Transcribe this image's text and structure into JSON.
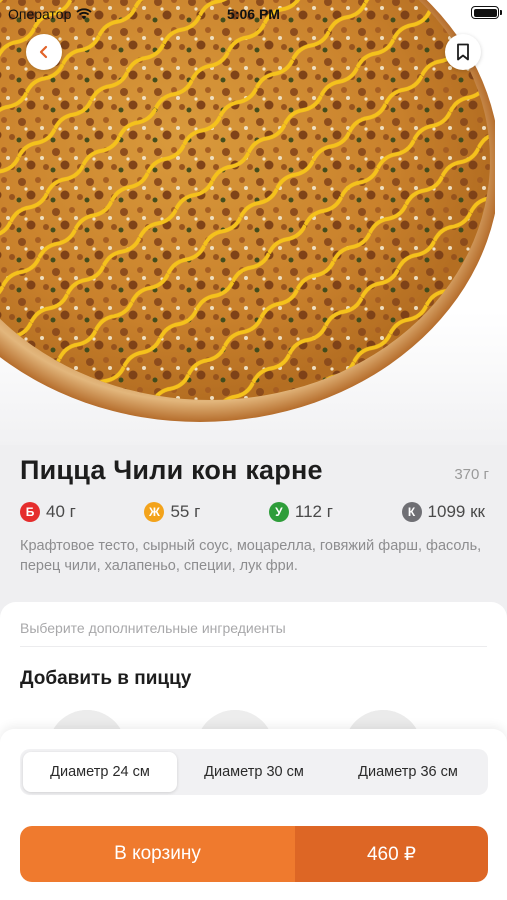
{
  "status_bar": {
    "carrier": "Оператор",
    "time": "5:06 PM"
  },
  "icons": {
    "back": "chevron-left-icon",
    "bookmark": "bookmark-icon",
    "wifi": "wifi-icon",
    "battery": "battery-icon"
  },
  "product": {
    "title": "Пицца Чили кон карне",
    "weight": "370 г",
    "description": "Крафтовое тесто, сырный соус, моцарелла, говяжий фарш, фасоль, перец чили, халапеньо, специи, лук фри."
  },
  "nutrition": [
    {
      "badge": "Б",
      "value": "40 г",
      "color": "#e52d2d"
    },
    {
      "badge": "Ж",
      "value": "55 г",
      "color": "#f3a31b"
    },
    {
      "badge": "У",
      "value": "112 г",
      "color": "#2e9d3a"
    },
    {
      "badge": "К",
      "value": "1099 кк",
      "color": "#6f6f74"
    }
  ],
  "extras": {
    "hint": "Выберите дополнительные ингредиенты",
    "title": "Добавить в пиццу"
  },
  "sizes": {
    "options": [
      "Диаметр 24 см",
      "Диаметр 30 см",
      "Диаметр 36 см"
    ],
    "selected": "Диаметр 24 см"
  },
  "cart": {
    "label": "В корзину",
    "price": "460 ₽"
  },
  "colors": {
    "accent": "#ef7a2e",
    "accent_dark": "#dd6625"
  }
}
